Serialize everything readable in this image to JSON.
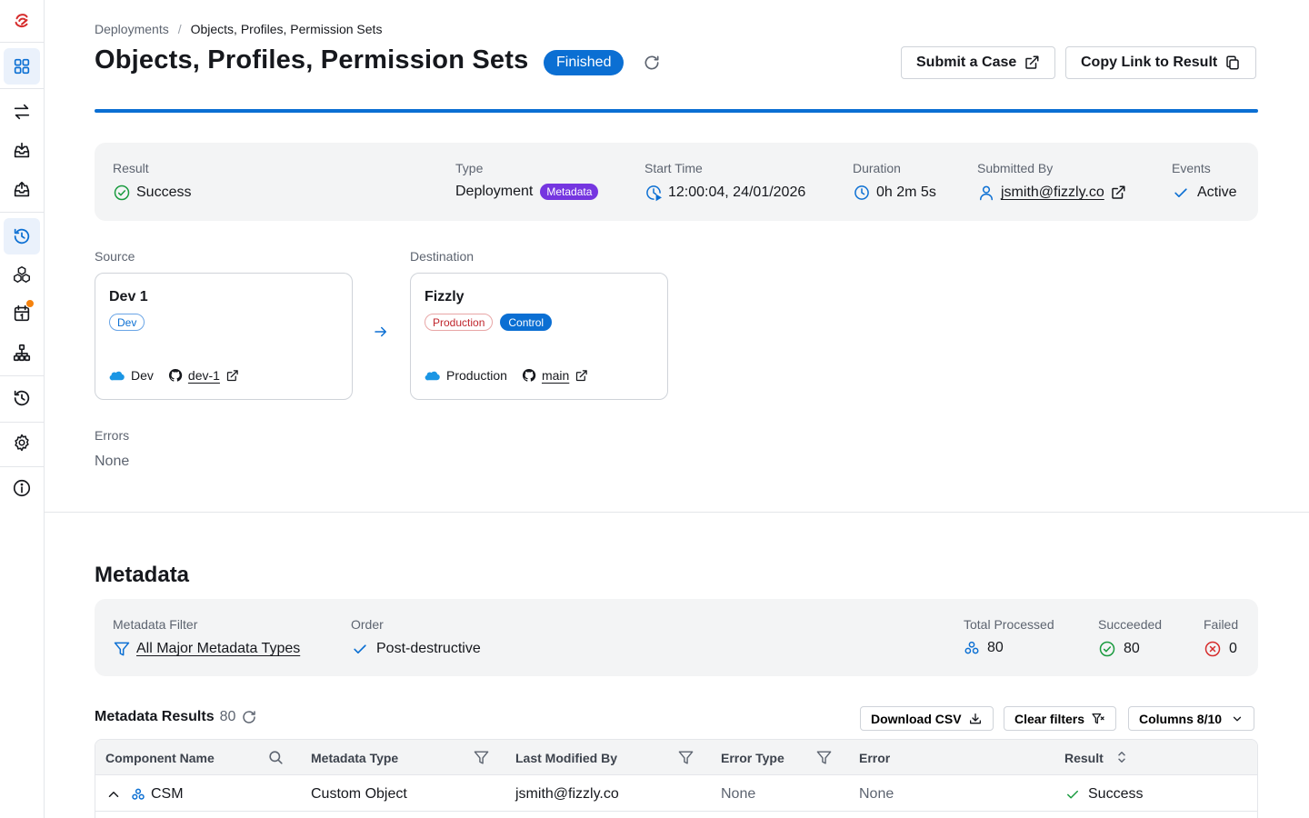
{
  "breadcrumb": {
    "parent": "Deployments",
    "separator": "/",
    "current": "Objects, Profiles, Permission Sets"
  },
  "header": {
    "title": "Objects, Profiles, Permission Sets",
    "status": "Finished",
    "submit_case": "Submit a Case",
    "copy_link": "Copy Link to Result"
  },
  "colors": {
    "accent": "#0b6fd3",
    "success": "#1a9b3f",
    "error": "#d62d2d",
    "purple": "#7536e0",
    "notification": "#f5820d"
  },
  "summary": {
    "result_label": "Result",
    "result_value": "Success",
    "type_label": "Type",
    "type_value": "Deployment",
    "type_badge": "Metadata",
    "start_label": "Start Time",
    "start_value": "12:00:04, 24/01/2026",
    "duration_label": "Duration",
    "duration_value": "0h 2m 5s",
    "submitted_label": "Submitted By",
    "submitted_value": "jsmith@fizzly.co",
    "events_label": "Events",
    "events_value": "Active"
  },
  "source": {
    "label": "Source",
    "name": "Dev 1",
    "tags": [
      "Dev"
    ],
    "env": "Dev",
    "branch": "dev-1"
  },
  "destination": {
    "label": "Destination",
    "name": "Fizzly",
    "tags": [
      "Production",
      "Control"
    ],
    "env": "Production",
    "branch": "main"
  },
  "errors": {
    "label": "Errors",
    "value": "None"
  },
  "metadata": {
    "title": "Metadata",
    "filter_label": "Metadata Filter",
    "filter_value": "All Major Metadata Types",
    "order_label": "Order",
    "order_value": "Post-destructive",
    "total_label": "Total Processed",
    "total_value": "80",
    "succeeded_label": "Succeeded",
    "succeeded_value": "80",
    "failed_label": "Failed",
    "failed_value": "0"
  },
  "results": {
    "title": "Metadata Results",
    "count": "80",
    "download_csv": "Download CSV",
    "clear_filters": "Clear filters",
    "columns": "Columns 8/10",
    "columns_headers": [
      "Component Name",
      "Metadata Type",
      "Last Modified By",
      "Error Type",
      "Error",
      "Result"
    ],
    "rows": [
      {
        "component": "CSM",
        "type": "Custom Object",
        "modified_by": "jsmith@fizzly.co",
        "error_type": "None",
        "error": "None",
        "result": "Success"
      }
    ]
  }
}
